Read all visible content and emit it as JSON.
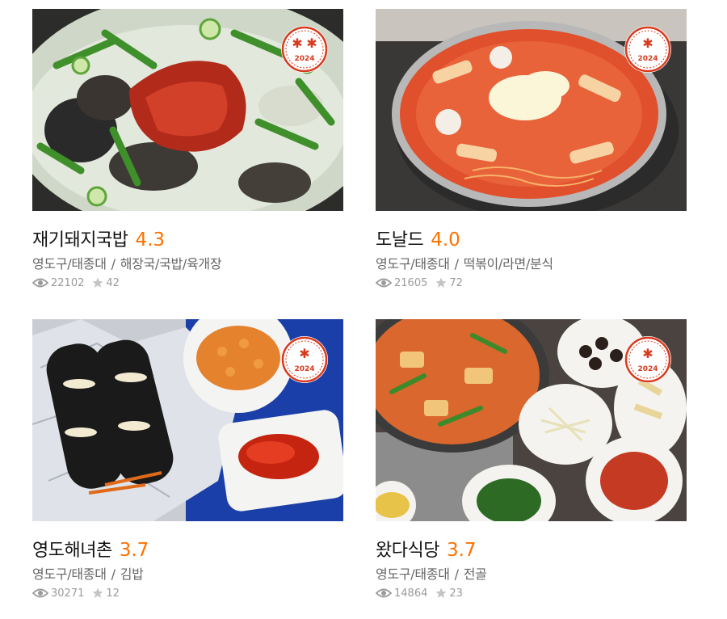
{
  "restaurants": [
    {
      "name": "재기돼지국밥",
      "score": "4.3",
      "area": "영도구/태종대",
      "category": "해장국/국밥/육개장",
      "views": "22102",
      "reviews": "42",
      "badge_year": "2024",
      "badge_marks": 2,
      "photo_theme": "gukbap"
    },
    {
      "name": "도날드",
      "score": "4.0",
      "area": "영도구/태종대",
      "category": "떡볶이/라면/분식",
      "views": "21605",
      "reviews": "72",
      "badge_year": "2024",
      "badge_marks": 1,
      "photo_theme": "tteokbokki"
    },
    {
      "name": "영도해녀촌",
      "score": "3.7",
      "area": "영도구/태종대",
      "category": "김밥",
      "views": "30271",
      "reviews": "12",
      "badge_year": "2024",
      "badge_marks": 1,
      "photo_theme": "gimbap"
    },
    {
      "name": "왔다식당",
      "score": "3.7",
      "area": "영도구/태종대",
      "category": "전골",
      "views": "14864",
      "reviews": "23",
      "badge_year": "2024",
      "badge_marks": 1,
      "photo_theme": "jeongol"
    }
  ],
  "separator": "/",
  "colors": {
    "score": "#ff7100",
    "badge_red": "#d83a1e",
    "meta_text": "#666666",
    "stats_text": "#9a9a9a"
  },
  "icons": {
    "views": "eye-icon",
    "reviews": "star-icon"
  }
}
